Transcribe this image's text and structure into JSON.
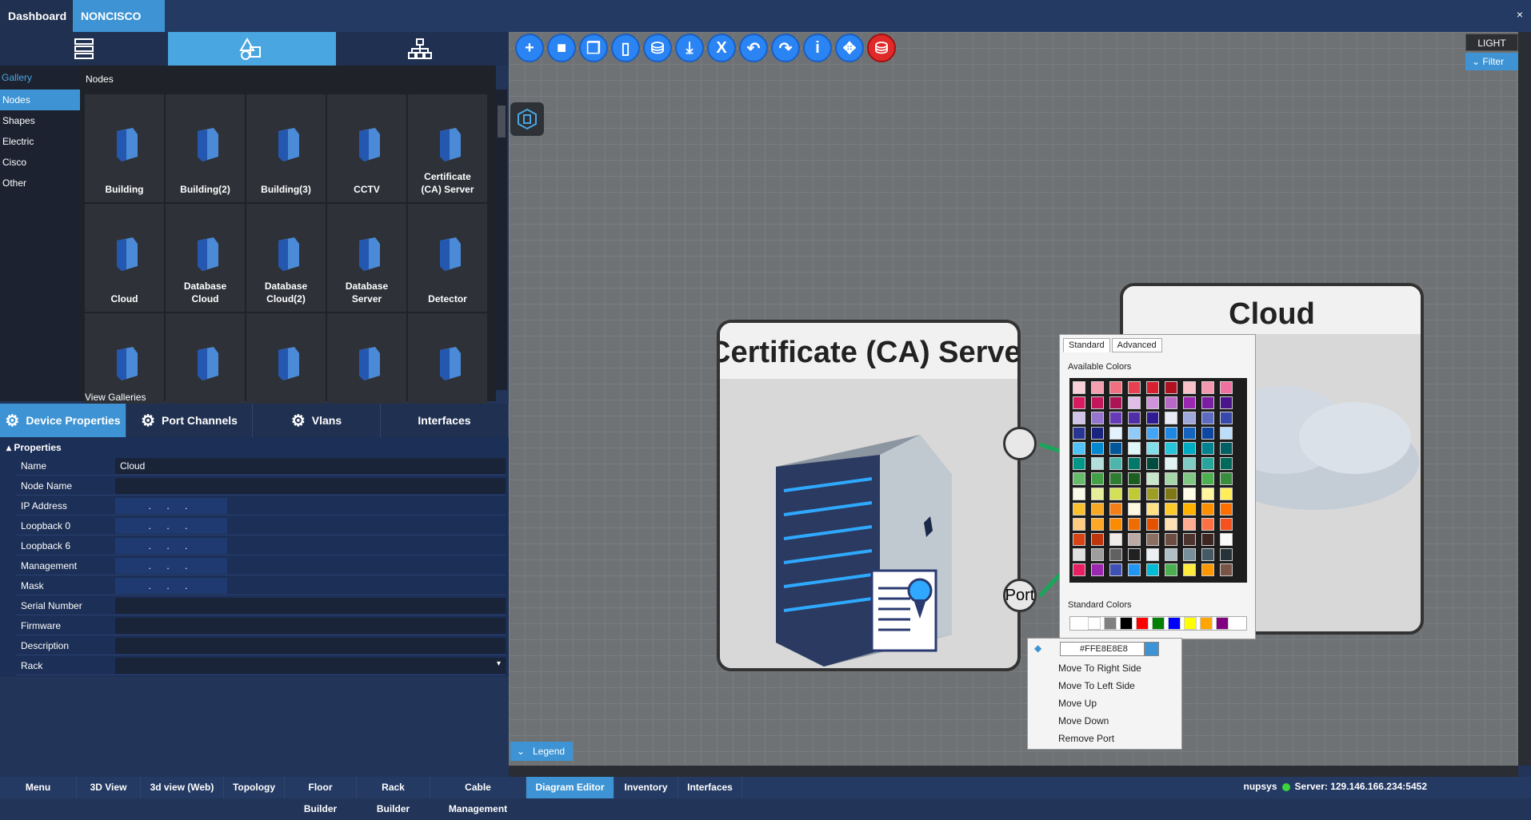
{
  "tabs": {
    "dashboard": "Dashboard",
    "noncisco": "NONCISCO",
    "close": "×"
  },
  "window": {
    "close": "×"
  },
  "modes": [
    {
      "name": "server-rack-icon"
    },
    {
      "name": "shapes-icon"
    },
    {
      "name": "topology-icon"
    }
  ],
  "gallery": {
    "header": "Gallery",
    "categories": [
      "Nodes",
      "Shapes",
      "Electric",
      "Cisco",
      "Other"
    ],
    "title": "Nodes",
    "view_galleries": "View Galleries",
    "tiles": [
      {
        "label": "Building",
        "icon": "building-icon"
      },
      {
        "label": "Building(2)",
        "icon": "building-icon"
      },
      {
        "label": "Building(3)",
        "icon": "building-icon"
      },
      {
        "label": "CCTV",
        "icon": "cctv-icon"
      },
      {
        "label": "Certificate\n(CA) Server",
        "icon": "server-icon"
      },
      {
        "label": "Cloud",
        "icon": "cloud-icon"
      },
      {
        "label": "Database\nCloud",
        "icon": "router-icon"
      },
      {
        "label": "Database\nCloud(2)",
        "icon": "router-icon"
      },
      {
        "label": "Database\nServer",
        "icon": "server-icon"
      },
      {
        "label": "Detector",
        "icon": "detector-icon"
      },
      {
        "label": "",
        "icon": "network-icon"
      },
      {
        "label": "",
        "icon": "switch-icon"
      },
      {
        "label": "",
        "icon": "mail-server-icon"
      },
      {
        "label": "",
        "icon": "device-icon"
      },
      {
        "label": "",
        "icon": "server-icon"
      }
    ]
  },
  "prop_tabs": [
    "Device Properties",
    "Port Channels",
    "Vlans",
    "Interfaces"
  ],
  "properties": {
    "header": "Properties",
    "rows": [
      {
        "key": "Name",
        "value": "Cloud",
        "type": "text"
      },
      {
        "key": "Node Name",
        "value": "",
        "type": "text"
      },
      {
        "key": "IP Address",
        "value": ". . .",
        "type": "ip"
      },
      {
        "key": "Loopback 0",
        "value": ". . .",
        "type": "ip"
      },
      {
        "key": "Loopback 6",
        "value": ". . .",
        "type": "ip"
      },
      {
        "key": "Management",
        "value": ". . .",
        "type": "ip"
      },
      {
        "key": "Mask",
        "value": ". . .",
        "type": "ip"
      },
      {
        "key": "Serial Number",
        "value": "",
        "type": "text"
      },
      {
        "key": "Firmware",
        "value": "",
        "type": "text"
      },
      {
        "key": "Description",
        "value": "",
        "type": "text"
      },
      {
        "key": "Rack",
        "value": "",
        "type": "select"
      }
    ]
  },
  "toolbar": {
    "buttons": [
      "+",
      "■",
      "❐",
      "▯",
      "⛁",
      "⤓",
      "X",
      "↶",
      "↷",
      "i",
      "✥",
      "⛁"
    ],
    "names": [
      "add-icon",
      "copy-icon",
      "duplicate-icon",
      "new-page-icon",
      "save-icon",
      "download-icon",
      "excel-icon",
      "undo-icon",
      "redo-icon",
      "info-icon",
      "move-icon",
      "delete-save-icon"
    ]
  },
  "theme": {
    "light": "LIGHT",
    "filter": "Filter"
  },
  "diagram": {
    "node_ca_title": "Certificate (CA) Server",
    "node_cloud_title": "Cloud",
    "port_label": "Port"
  },
  "color_picker": {
    "tab_standard": "Standard",
    "tab_advanced": "Advanced",
    "available": "Available Colors",
    "standard": "Standard Colors",
    "hex": "#FFE8E8E8",
    "standard_colors": [
      "#ffffff",
      "#808080",
      "#000000",
      "#ff0000",
      "#008000",
      "#0000ff",
      "#ffff00",
      "#ffa500",
      "#800080"
    ]
  },
  "context_menu": [
    "Move To Right Side",
    "Move To Left Side",
    "Move Up",
    "Move Down",
    "Remove Port"
  ],
  "legend": "Legend",
  "bottom": [
    "Menu",
    "3D View",
    "3d view (Web)",
    "Topology",
    "Floor Builder",
    "Rack Builder",
    "Cable Management",
    "Diagram Editor",
    "Inventory",
    "Interfaces"
  ],
  "status": {
    "user": "nupsys",
    "server": "Server: 129.146.166.234:5452"
  }
}
